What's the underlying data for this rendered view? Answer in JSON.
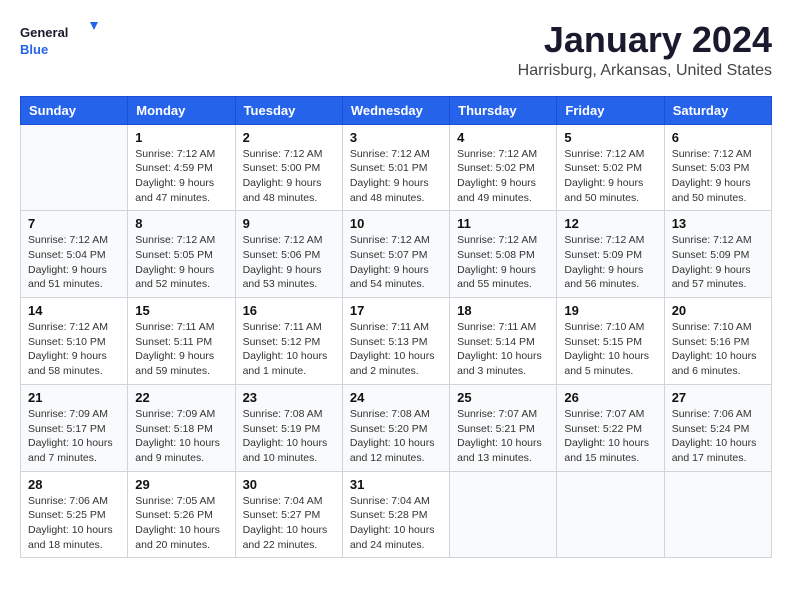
{
  "logo": {
    "line1": "General",
    "line2": "Blue"
  },
  "title": "January 2024",
  "location": "Harrisburg, Arkansas, United States",
  "days_of_week": [
    "Sunday",
    "Monday",
    "Tuesday",
    "Wednesday",
    "Thursday",
    "Friday",
    "Saturday"
  ],
  "weeks": [
    [
      {
        "num": "",
        "sunrise": "",
        "sunset": "",
        "daylight": ""
      },
      {
        "num": "1",
        "sunrise": "Sunrise: 7:12 AM",
        "sunset": "Sunset: 4:59 PM",
        "daylight": "Daylight: 9 hours and 47 minutes."
      },
      {
        "num": "2",
        "sunrise": "Sunrise: 7:12 AM",
        "sunset": "Sunset: 5:00 PM",
        "daylight": "Daylight: 9 hours and 48 minutes."
      },
      {
        "num": "3",
        "sunrise": "Sunrise: 7:12 AM",
        "sunset": "Sunset: 5:01 PM",
        "daylight": "Daylight: 9 hours and 48 minutes."
      },
      {
        "num": "4",
        "sunrise": "Sunrise: 7:12 AM",
        "sunset": "Sunset: 5:02 PM",
        "daylight": "Daylight: 9 hours and 49 minutes."
      },
      {
        "num": "5",
        "sunrise": "Sunrise: 7:12 AM",
        "sunset": "Sunset: 5:02 PM",
        "daylight": "Daylight: 9 hours and 50 minutes."
      },
      {
        "num": "6",
        "sunrise": "Sunrise: 7:12 AM",
        "sunset": "Sunset: 5:03 PM",
        "daylight": "Daylight: 9 hours and 50 minutes."
      }
    ],
    [
      {
        "num": "7",
        "sunrise": "Sunrise: 7:12 AM",
        "sunset": "Sunset: 5:04 PM",
        "daylight": "Daylight: 9 hours and 51 minutes."
      },
      {
        "num": "8",
        "sunrise": "Sunrise: 7:12 AM",
        "sunset": "Sunset: 5:05 PM",
        "daylight": "Daylight: 9 hours and 52 minutes."
      },
      {
        "num": "9",
        "sunrise": "Sunrise: 7:12 AM",
        "sunset": "Sunset: 5:06 PM",
        "daylight": "Daylight: 9 hours and 53 minutes."
      },
      {
        "num": "10",
        "sunrise": "Sunrise: 7:12 AM",
        "sunset": "Sunset: 5:07 PM",
        "daylight": "Daylight: 9 hours and 54 minutes."
      },
      {
        "num": "11",
        "sunrise": "Sunrise: 7:12 AM",
        "sunset": "Sunset: 5:08 PM",
        "daylight": "Daylight: 9 hours and 55 minutes."
      },
      {
        "num": "12",
        "sunrise": "Sunrise: 7:12 AM",
        "sunset": "Sunset: 5:09 PM",
        "daylight": "Daylight: 9 hours and 56 minutes."
      },
      {
        "num": "13",
        "sunrise": "Sunrise: 7:12 AM",
        "sunset": "Sunset: 5:09 PM",
        "daylight": "Daylight: 9 hours and 57 minutes."
      }
    ],
    [
      {
        "num": "14",
        "sunrise": "Sunrise: 7:12 AM",
        "sunset": "Sunset: 5:10 PM",
        "daylight": "Daylight: 9 hours and 58 minutes."
      },
      {
        "num": "15",
        "sunrise": "Sunrise: 7:11 AM",
        "sunset": "Sunset: 5:11 PM",
        "daylight": "Daylight: 9 hours and 59 minutes."
      },
      {
        "num": "16",
        "sunrise": "Sunrise: 7:11 AM",
        "sunset": "Sunset: 5:12 PM",
        "daylight": "Daylight: 10 hours and 1 minute."
      },
      {
        "num": "17",
        "sunrise": "Sunrise: 7:11 AM",
        "sunset": "Sunset: 5:13 PM",
        "daylight": "Daylight: 10 hours and 2 minutes."
      },
      {
        "num": "18",
        "sunrise": "Sunrise: 7:11 AM",
        "sunset": "Sunset: 5:14 PM",
        "daylight": "Daylight: 10 hours and 3 minutes."
      },
      {
        "num": "19",
        "sunrise": "Sunrise: 7:10 AM",
        "sunset": "Sunset: 5:15 PM",
        "daylight": "Daylight: 10 hours and 5 minutes."
      },
      {
        "num": "20",
        "sunrise": "Sunrise: 7:10 AM",
        "sunset": "Sunset: 5:16 PM",
        "daylight": "Daylight: 10 hours and 6 minutes."
      }
    ],
    [
      {
        "num": "21",
        "sunrise": "Sunrise: 7:09 AM",
        "sunset": "Sunset: 5:17 PM",
        "daylight": "Daylight: 10 hours and 7 minutes."
      },
      {
        "num": "22",
        "sunrise": "Sunrise: 7:09 AM",
        "sunset": "Sunset: 5:18 PM",
        "daylight": "Daylight: 10 hours and 9 minutes."
      },
      {
        "num": "23",
        "sunrise": "Sunrise: 7:08 AM",
        "sunset": "Sunset: 5:19 PM",
        "daylight": "Daylight: 10 hours and 10 minutes."
      },
      {
        "num": "24",
        "sunrise": "Sunrise: 7:08 AM",
        "sunset": "Sunset: 5:20 PM",
        "daylight": "Daylight: 10 hours and 12 minutes."
      },
      {
        "num": "25",
        "sunrise": "Sunrise: 7:07 AM",
        "sunset": "Sunset: 5:21 PM",
        "daylight": "Daylight: 10 hours and 13 minutes."
      },
      {
        "num": "26",
        "sunrise": "Sunrise: 7:07 AM",
        "sunset": "Sunset: 5:22 PM",
        "daylight": "Daylight: 10 hours and 15 minutes."
      },
      {
        "num": "27",
        "sunrise": "Sunrise: 7:06 AM",
        "sunset": "Sunset: 5:24 PM",
        "daylight": "Daylight: 10 hours and 17 minutes."
      }
    ],
    [
      {
        "num": "28",
        "sunrise": "Sunrise: 7:06 AM",
        "sunset": "Sunset: 5:25 PM",
        "daylight": "Daylight: 10 hours and 18 minutes."
      },
      {
        "num": "29",
        "sunrise": "Sunrise: 7:05 AM",
        "sunset": "Sunset: 5:26 PM",
        "daylight": "Daylight: 10 hours and 20 minutes."
      },
      {
        "num": "30",
        "sunrise": "Sunrise: 7:04 AM",
        "sunset": "Sunset: 5:27 PM",
        "daylight": "Daylight: 10 hours and 22 minutes."
      },
      {
        "num": "31",
        "sunrise": "Sunrise: 7:04 AM",
        "sunset": "Sunset: 5:28 PM",
        "daylight": "Daylight: 10 hours and 24 minutes."
      },
      {
        "num": "",
        "sunrise": "",
        "sunset": "",
        "daylight": ""
      },
      {
        "num": "",
        "sunrise": "",
        "sunset": "",
        "daylight": ""
      },
      {
        "num": "",
        "sunrise": "",
        "sunset": "",
        "daylight": ""
      }
    ]
  ]
}
